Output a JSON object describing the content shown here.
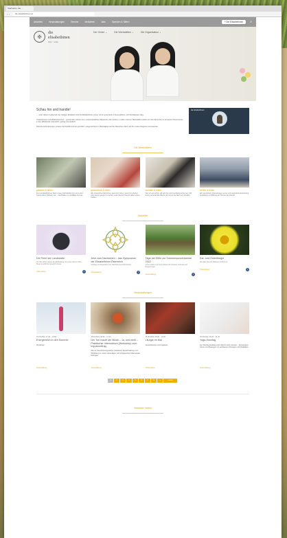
{
  "browser": {
    "tab_title": "Startseite | die ...",
    "url": "die-elisabethinen.at"
  },
  "nav": {
    "items": [
      "Aktuelles",
      "Veranstaltungen",
      "Termine",
      "Mediathek",
      "Jobs",
      "Spenden & Stiften"
    ],
    "button": "+ Die Elisabethinen"
  },
  "brand": {
    "name_line1": "die",
    "name_line2": "elisabethinen",
    "sub": "linz · wien"
  },
  "hero_menu": [
    "Der Orden ⌄",
    "Die Werkstätten ⌄",
    "Die Organisation ⌄"
  ],
  "intro": {
    "title": "Schau hin und handle!",
    "p1": "… unter diesem Leitspruch der heiligen Elisabeth sind die Elisabethinen schon immer grenzlenk im Gesundheits- und Sozialwesen tätig.",
    "p2": "Ordensfrauen und Mitarbeiterinnen – gemeinsam wirken sie in unterschiedlichen Bereichen des Lebens. In allen unseren Werkstätten stellen wir den Menschen in all seinen Dimensionen in den Mittelpunkt: körperlich, geistig und seelisch.",
    "p3": "Was die Anforderungen unserer Zeit betrifft sind wir gefordert, ausgezeichnet in Werkstätten auf die Menschen darin und für unsere Regionen einzusetzen.",
    "video_title": "die elisabethinen"
  },
  "sections": {
    "werk": "Die Werkstätten",
    "news": "Aktuelles",
    "events": "Veranstaltungen",
    "unterstuetzen": "Vertrauen helfen"
  },
  "werkstaetten": [
    {
      "title": "glauben & leben",
      "text": "Für uns Elisabethinen bildet unsere Spiritualität hinter der Leben, zweiter allem Wirksam sein – Nachhalten zur vielfältige Impulse."
    },
    {
      "title": "gesundheit & leben",
      "text": "Wir unterstützen Menschen, gesund zu leben, gesund zu bleiben oder wieder gesund zu werden, jeder Mensch braucht dabei wissen Kräften."
    },
    {
      "title": "wohnen & leben",
      "text": "Wer wir uns wohnt, soll sich frei und zuverlässig sicher sein. Wir bieten Lebenskrafte Räume für uns an die Welt zum Schaffen."
    },
    {
      "title": "lernen & leben",
      "text": "Wir unterstützen lebenslanges Lernen und persönliche Entwicklung. Ausbildung und Bildung als Themen der Zukunft."
    }
  ],
  "news": [
    {
      "title": "Die Perle der Landstraße",
      "text": "Vor 300 Jahren bauten die Elisabethinen ihr erstes Haus in Wien. Diese Geschichte bewegt bis heute.",
      "tag": "Ordensleben"
    },
    {
      "title": "Jetzt zum Nachsehen – das Symposium der Elisabethinen Österreich",
      "text": "Vorträge und Gespräche zum Nachhören und Nachsehen.",
      "tag": "Veranstaltung"
    },
    {
      "title": "Tage der 500e zur Sommersonnenwende 2022",
      "text": "Grüne Gärten und Sommerfeste mit Impulsen, Gebeten und Begegnungen.",
      "tag": "Veranstaltung"
    },
    {
      "title": "Kar- und Osterliturgie",
      "text": "Wir laden Sie zum Mitfeiern herzlich ein.",
      "tag": "Ordensleben"
    }
  ],
  "events": [
    {
      "date": "15.08.2022, 17:00 – 18:00",
      "title": "Energiereich in den Sommer",
      "body": "Workshop",
      "tag": "Veranstaltung"
    },
    {
      "date": "16.08.2022, 16:00 – 17:00",
      "title": "Der Ton macht die Musik – Ja, und weiß – Praktischer Intensivkurs (Workshop) zum Impulsvortrag",
      "body": "Wie ein freudvoll eingesetzte Gedanken Sprachhaltung und Wohlklang zu einem lebendigen und erfolgreichen Miteinander beitragen.",
      "tag": "Veranstaltung"
    },
    {
      "date": "15.08.2022, 09:00 – 10:00",
      "title": "Liturgie im Mai",
      "body": "Gottesdienste und Angebote",
      "tag": "Ordensleben"
    },
    {
      "date": "15.09.2022, 09:30 – 11:30",
      "title": "Yoga-Sonntag",
      "body": "Am Wochenausklang sich Zeit für sich nehmen – Entspannen, Atmen und Bewegen mit achtsamen Übungen und Meditation.",
      "tag": "Veranstaltung"
    }
  ],
  "pager": [
    "1",
    "2",
    "3",
    "4",
    "5",
    "6",
    "7",
    "8",
    "»",
    "Letzte"
  ],
  "colors": {
    "accent": "#e8a200",
    "nav": "#9a9a9a"
  }
}
